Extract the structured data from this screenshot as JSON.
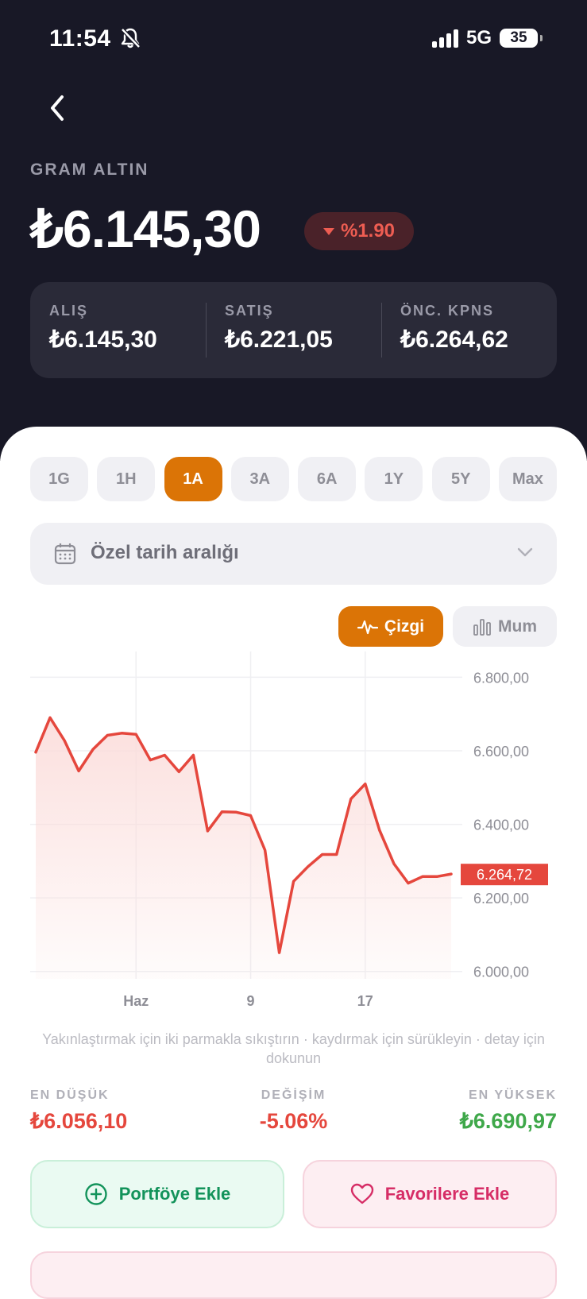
{
  "status_bar": {
    "time": "11:54",
    "network": "5G",
    "battery": "35",
    "icons": [
      "bell-slash-icon",
      "signal-icon",
      "battery-icon"
    ]
  },
  "asset": {
    "name": "GRAM ALTIN",
    "price": "₺6.145,30",
    "change": "%1.90",
    "change_direction": "down",
    "stats": [
      {
        "label": "ALIŞ",
        "value": "₺6.145,30"
      },
      {
        "label": "SATIŞ",
        "value": "₺6.221,05"
      },
      {
        "label": "ÖNC. KPNS",
        "value": "₺6.264,62"
      }
    ]
  },
  "periods": {
    "items": [
      "1G",
      "1H",
      "1A",
      "3A",
      "6A",
      "1Y",
      "5Y",
      "Max"
    ],
    "selected": "1A"
  },
  "date_range": {
    "label": "Özel tarih aralığı"
  },
  "chart_type": {
    "line": "Çizgi",
    "candle": "Mum",
    "selected": "line"
  },
  "chart_data": {
    "type": "area",
    "y_tick_labels": [
      "6.800,00",
      "6.600,00",
      "6.400,00",
      "6.200,00",
      "6.000,00"
    ],
    "y_ticks": [
      6800,
      6600,
      6400,
      6200,
      6000
    ],
    "ylim": [
      5980,
      6870
    ],
    "x_tick_labels": [
      "Haz",
      "9",
      "17"
    ],
    "x_tick_index": [
      7,
      15,
      23
    ],
    "values": [
      6596,
      6690,
      6628,
      6545,
      6604,
      6642,
      6648,
      6645,
      6575,
      6588,
      6543,
      6588,
      6382,
      6434,
      6433,
      6424,
      6330,
      6051,
      6245,
      6285,
      6318,
      6318,
      6469,
      6510,
      6384,
      6293,
      6240,
      6258,
      6258,
      6265
    ],
    "current_label": "6.264,72",
    "current_value": 6264.72,
    "line_color": "#e5473d",
    "fill_color": "#fbdcda"
  },
  "hint": "Yakınlaştırmak için iki parmakla sıkıştırın · kaydırmak için sürükleyin · detay için dokunun",
  "summary": {
    "low_label": "EN DÜŞÜK",
    "low_value": "₺6.056,10",
    "change_label": "DEĞİŞİM",
    "change_value": "-5.06%",
    "high_label": "EN YÜKSEK",
    "high_value": "₺6.690,97"
  },
  "actions": {
    "portfolio": "Portföye Ekle",
    "favorites": "Favorilere Ekle"
  },
  "colors": {
    "accent": "#db7406",
    "negative": "#e5473d",
    "positive": "#3fa84a",
    "header_bg": "#181826"
  }
}
